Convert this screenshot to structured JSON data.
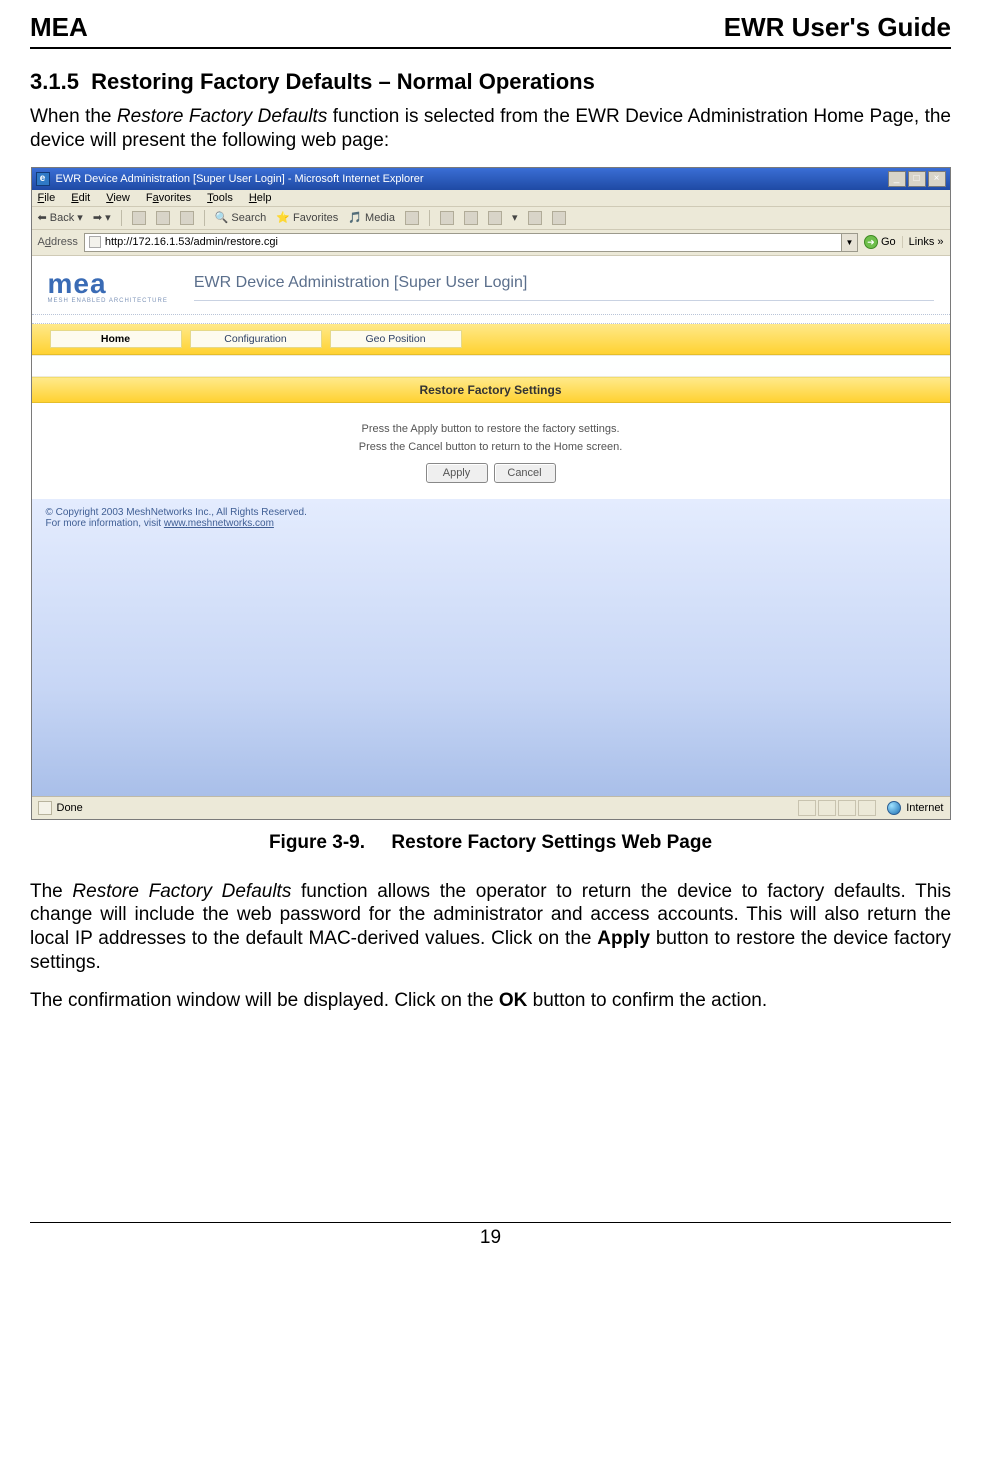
{
  "header": {
    "left": "MEA",
    "right": "EWR User's Guide"
  },
  "section": {
    "number": "3.1.5",
    "title": "Restoring Factory Defaults – Normal Operations"
  },
  "intro": {
    "pre": "When the ",
    "ital": "Restore Factory Defaults",
    "post": " function is selected from the EWR Device Administration Home Page, the device will present the following web page:"
  },
  "browser": {
    "title": "EWR Device Administration [Super User Login] - Microsoft Internet Explorer",
    "menus": {
      "file": "File",
      "edit": "Edit",
      "view": "View",
      "favorites": "Favorites",
      "tools": "Tools",
      "help": "Help"
    },
    "tools": {
      "back": "Back",
      "search": "Search",
      "favorites": "Favorites",
      "media": "Media"
    },
    "addrLabel": "Address",
    "url": "http://172.16.1.53/admin/restore.cgi",
    "go": "Go",
    "links": "Links »",
    "logo": {
      "main": "mea",
      "sub": "MESH ENABLED ARCHITECTURE"
    },
    "pageTitle": "EWR Device Administration [Super User Login]",
    "tabs": {
      "home": "Home",
      "config": "Configuration",
      "geo": "Geo Position"
    },
    "panel": {
      "heading": "Restore Factory Settings",
      "line1": "Press the Apply button to restore the factory settings.",
      "line2": "Press the Cancel button to return to the Home screen.",
      "apply": "Apply",
      "cancel": "Cancel"
    },
    "copyright": {
      "line1": "© Copyright 2003 MeshNetworks Inc., All Rights Reserved.",
      "line2pre": "For more information, visit ",
      "link": "www.meshnetworks.com"
    },
    "status": {
      "done": "Done",
      "zone": "Internet"
    }
  },
  "figure": {
    "num": "Figure 3-9.",
    "title": "Restore Factory Settings Web Page"
  },
  "para1": {
    "pre": "The ",
    "ital": "Restore Factory Defaults",
    "mid": " function allows the operator to return the device to factory defaults. This change will include the web password for the administrator and access accounts. This will also return the local IP addresses to the default MAC-derived values.  Click on the ",
    "bold": "Apply",
    "post": " button to restore the device factory settings."
  },
  "para2": {
    "pre": "The confirmation window will be displayed. Click on the ",
    "bold": "OK",
    "post": " button to confirm the action."
  },
  "pageNum": "19"
}
